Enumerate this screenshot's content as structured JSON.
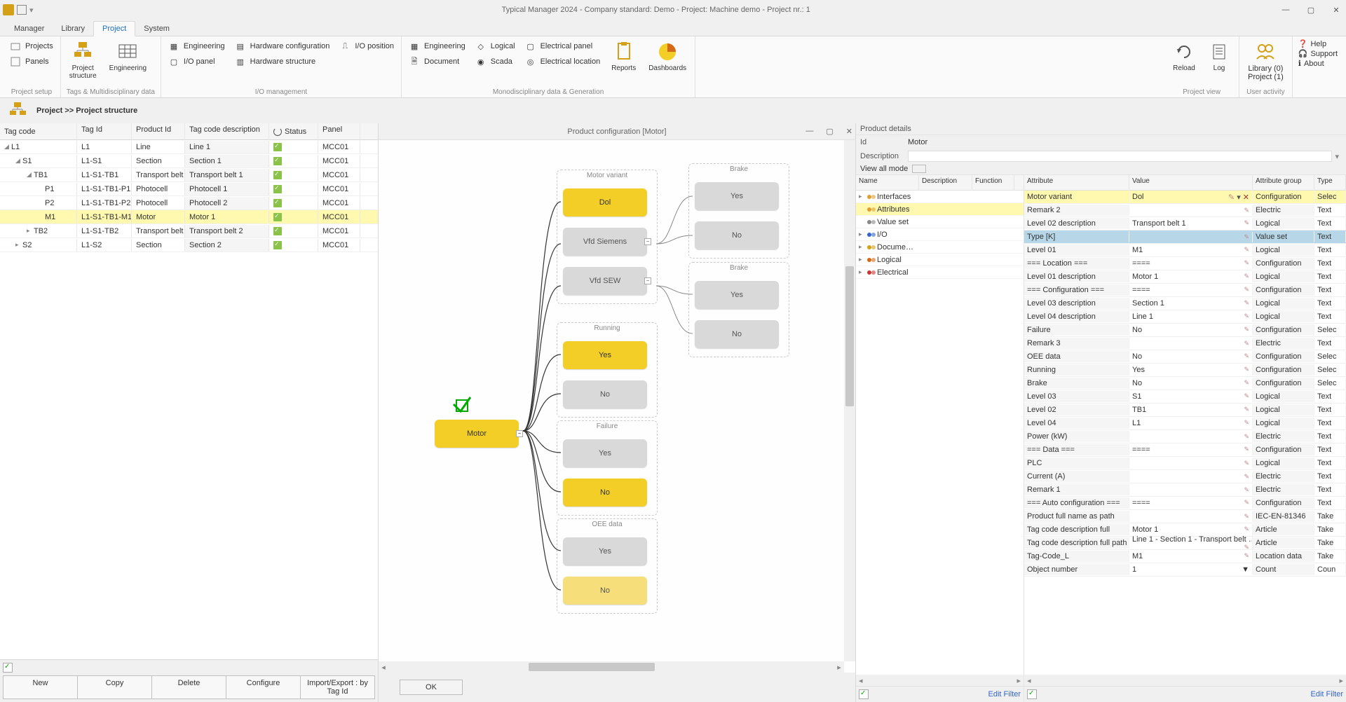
{
  "titlebar": {
    "title": "Typical Manager 2024 - Company standard: Demo - Project: Machine demo - Project nr.: 1"
  },
  "tabs": {
    "manager": "Manager",
    "library": "Library",
    "project": "Project",
    "system": "System"
  },
  "ribbon": {
    "group1_title": "Project setup",
    "projects": "Projects",
    "panels": "Panels",
    "group2_title": "Tags & Multidisciplinary data",
    "proj_structure": "Project\nstructure",
    "engineering_big": "Engineering",
    "group3_title": "I/O management",
    "engineering": "Engineering",
    "iopanel": "I/O panel",
    "hwconfig": "Hardware configuration",
    "hwstruct": "Hardware structure",
    "ioposition": "I/O position",
    "group4_title": "Monodisciplinary data & Generation",
    "engineering2": "Engineering",
    "document": "Document",
    "logical": "Logical",
    "scada": "Scada",
    "epanel": "Electrical panel",
    "elocation": "Electrical location",
    "reports": "Reports",
    "dashboards": "Dashboards",
    "group5_title": "Project view",
    "reload": "Reload",
    "log": "Log",
    "group6_title": "User activity",
    "library_state": "Library (0)",
    "project_state": "Project (1)",
    "help": "Help",
    "support": "Support",
    "about": "About"
  },
  "breadcrumb": "Project >> Project structure",
  "tree": {
    "headers": {
      "tagcode": "Tag code",
      "tagid": "Tag Id",
      "prodid": "Product Id",
      "desc": "Tag code description",
      "status": "Status",
      "panel": "Panel"
    },
    "rows": [
      {
        "indent": 0,
        "exp": "◢",
        "tag": "L1",
        "id": "L1",
        "prod": "Line",
        "desc": "Line 1",
        "panel": "MCC01",
        "sel": false
      },
      {
        "indent": 1,
        "exp": "◢",
        "tag": "S1",
        "id": "L1-S1",
        "prod": "Section",
        "desc": "Section 1",
        "panel": "MCC01",
        "sel": false
      },
      {
        "indent": 2,
        "exp": "◢",
        "tag": "TB1",
        "id": "L1-S1-TB1",
        "prod": "Transport belt",
        "desc": "Transport belt 1",
        "panel": "MCC01",
        "sel": false
      },
      {
        "indent": 3,
        "exp": "",
        "tag": "P1",
        "id": "L1-S1-TB1-P1",
        "prod": "Photocell",
        "desc": "Photocell 1",
        "panel": "MCC01",
        "sel": false
      },
      {
        "indent": 3,
        "exp": "",
        "tag": "P2",
        "id": "L1-S1-TB1-P2",
        "prod": "Photocell",
        "desc": "Photocell 2",
        "panel": "MCC01",
        "sel": false
      },
      {
        "indent": 3,
        "exp": "",
        "tag": "M1",
        "id": "L1-S1-TB1-M1",
        "prod": "Motor",
        "desc": "Motor 1",
        "panel": "MCC01",
        "sel": true
      },
      {
        "indent": 2,
        "exp": "▸",
        "tag": "TB2",
        "id": "L1-S1-TB2",
        "prod": "Transport belt",
        "desc": "Transport belt 2",
        "panel": "MCC01",
        "sel": false
      },
      {
        "indent": 1,
        "exp": "▸",
        "tag": "S2",
        "id": "L1-S2",
        "prod": "Section",
        "desc": "Section 2",
        "panel": "MCC01",
        "sel": false
      }
    ],
    "buttons": {
      "new": "New",
      "copy": "Copy",
      "delete": "Delete",
      "configure": "Configure",
      "importexport": "Import/Export : by Tag Id"
    }
  },
  "canvas": {
    "title": "Product configuration [Motor]",
    "ok": "OK",
    "root": "Motor",
    "groups": {
      "motor_variant": {
        "label": "Motor variant",
        "opts": [
          "Dol",
          "Vfd Siemens",
          "Vfd SEW"
        ]
      },
      "running": {
        "label": "Running",
        "opts": [
          "Yes",
          "No"
        ]
      },
      "failure": {
        "label": "Failure",
        "opts": [
          "Yes",
          "No"
        ]
      },
      "oee": {
        "label": "OEE data",
        "opts": [
          "Yes",
          "No"
        ]
      },
      "brake1": {
        "label": "Brake",
        "opts": [
          "Yes",
          "No"
        ]
      },
      "brake2": {
        "label": "Brake",
        "opts": [
          "Yes",
          "No"
        ]
      }
    }
  },
  "details": {
    "title": "Product details",
    "id_lbl": "Id",
    "id_val": "Motor",
    "desc_lbl": "Description",
    "viewall": "View all mode",
    "left_headers": {
      "name": "Name",
      "desc": "Description",
      "func": "Function"
    },
    "left_rows": [
      {
        "exp": "▸",
        "name": "Interfaces",
        "color": "#e0a030",
        "sel": false
      },
      {
        "exp": "",
        "name": "Attributes",
        "color": "#e0a030",
        "sel": true
      },
      {
        "exp": "",
        "name": "Value set",
        "color": "#888",
        "sel": false
      },
      {
        "exp": "▸",
        "name": "I/O",
        "color": "#3366cc",
        "sel": false
      },
      {
        "exp": "▸",
        "name": "Docume…",
        "color": "#d4a017",
        "sel": false
      },
      {
        "exp": "▸",
        "name": "Logical",
        "color": "#d46a17",
        "sel": false
      },
      {
        "exp": "▸",
        "name": "Electrical",
        "color": "#cc3333",
        "sel": false
      }
    ],
    "right_headers": {
      "attr": "Attribute",
      "val": "Value",
      "grp": "Attribute group",
      "type": "Type"
    },
    "right_rows": [
      {
        "attr": "Motor variant",
        "val": "Dol",
        "grp": "Configuration",
        "type": "Selec",
        "hl": "yellow",
        "icons": true
      },
      {
        "attr": "Remark 2",
        "val": "",
        "grp": "Electric",
        "type": "Text"
      },
      {
        "attr": "Level 02 description",
        "val": "Transport belt 1",
        "grp": "Logical",
        "type": "Text"
      },
      {
        "attr": "Type [K]",
        "val": "",
        "grp": "Value set",
        "type": "Text",
        "hl": "blue"
      },
      {
        "attr": "Level 01",
        "val": "M1",
        "grp": "Logical",
        "type": "Text"
      },
      {
        "attr": "=== Location ===",
        "val": "====",
        "grp": "Configuration",
        "type": "Text"
      },
      {
        "attr": "Level 01 description",
        "val": "Motor 1",
        "grp": "Logical",
        "type": "Text"
      },
      {
        "attr": "=== Configuration ===",
        "val": "====",
        "grp": "Configuration",
        "type": "Text"
      },
      {
        "attr": "Level 03 description",
        "val": "Section 1",
        "grp": "Logical",
        "type": "Text"
      },
      {
        "attr": "Level 04 description",
        "val": "Line 1",
        "grp": "Logical",
        "type": "Text"
      },
      {
        "attr": "Failure",
        "val": "No",
        "grp": "Configuration",
        "type": "Selec"
      },
      {
        "attr": "Remark 3",
        "val": "",
        "grp": "Electric",
        "type": "Text"
      },
      {
        "attr": "OEE data",
        "val": "No",
        "grp": "Configuration",
        "type": "Selec"
      },
      {
        "attr": "Running",
        "val": "Yes",
        "grp": "Configuration",
        "type": "Selec"
      },
      {
        "attr": "Brake",
        "val": "No",
        "grp": "Configuration",
        "type": "Selec"
      },
      {
        "attr": "Level 03",
        "val": "S1",
        "grp": "Logical",
        "type": "Text"
      },
      {
        "attr": "Level 02",
        "val": "TB1",
        "grp": "Logical",
        "type": "Text"
      },
      {
        "attr": "Level 04",
        "val": "L1",
        "grp": "Logical",
        "type": "Text"
      },
      {
        "attr": "Power (kW)",
        "val": "",
        "grp": "Electric",
        "type": "Text"
      },
      {
        "attr": "=== Data ===",
        "val": "====",
        "grp": "Configuration",
        "type": "Text"
      },
      {
        "attr": "PLC",
        "val": "",
        "grp": "Logical",
        "type": "Text"
      },
      {
        "attr": "Current (A)",
        "val": "",
        "grp": "Electric",
        "type": "Text"
      },
      {
        "attr": "Remark 1",
        "val": "",
        "grp": "Electric",
        "type": "Text"
      },
      {
        "attr": "=== Auto configuration ===",
        "val": "====",
        "grp": "Configuration",
        "type": "Text"
      },
      {
        "attr": "Product full name as path",
        "val": "",
        "grp": "IEC-EN-81346",
        "type": "Take"
      },
      {
        "attr": "Tag code description full",
        "val": "Motor 1",
        "grp": "Article",
        "type": "Take"
      },
      {
        "attr": "Tag code description full path",
        "val": "Line 1 - Section 1 - Transport belt …",
        "grp": "Article",
        "type": "Take"
      },
      {
        "attr": "Tag-Code_L",
        "val": "M1",
        "grp": "Location data",
        "type": "Take"
      },
      {
        "attr": "Object number",
        "val": "1",
        "grp": "Count",
        "type": "Coun",
        "filter": true
      }
    ],
    "edit_filter": "Edit Filter"
  }
}
